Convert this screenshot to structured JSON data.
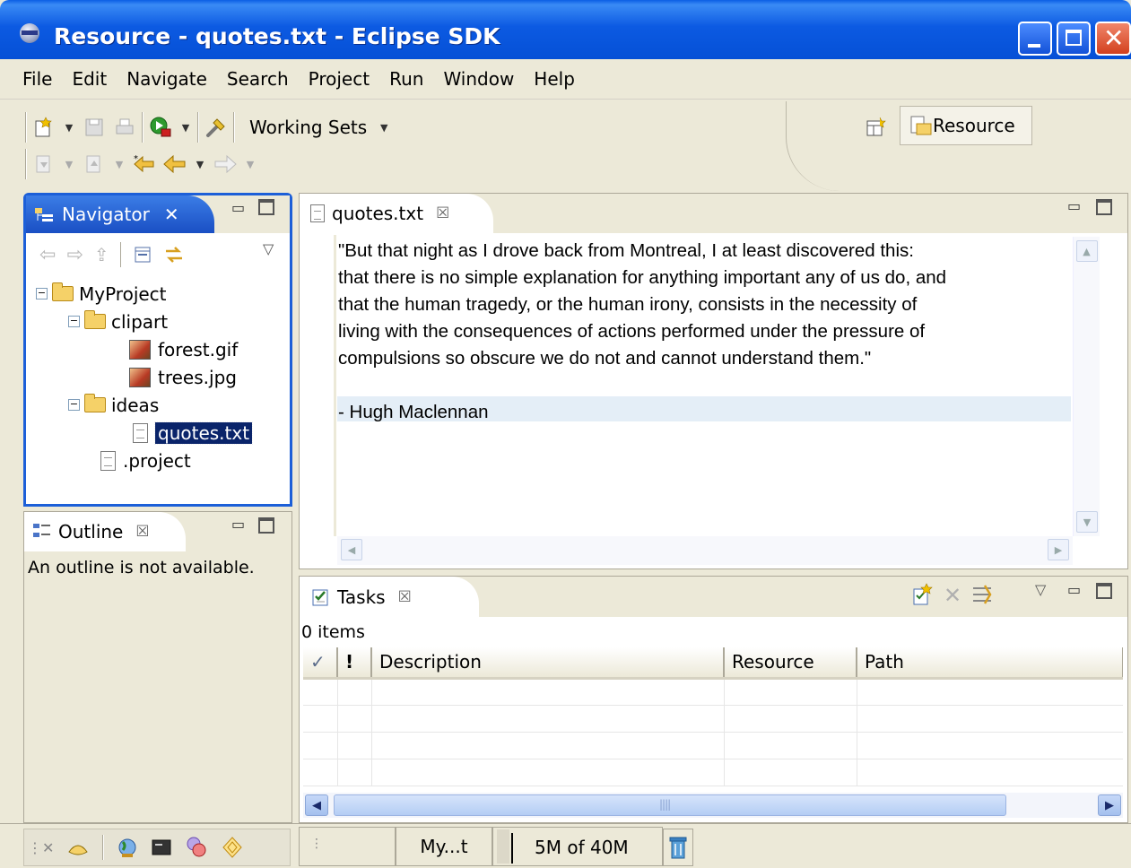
{
  "window": {
    "title": "Resource - quotes.txt - Eclipse SDK",
    "controls": [
      "minimize",
      "maximize",
      "close"
    ]
  },
  "menubar": {
    "items": [
      "File",
      "Edit",
      "Navigate",
      "Search",
      "Project",
      "Run",
      "Window",
      "Help"
    ]
  },
  "toolbar": {
    "working_sets_label": "Working Sets",
    "perspective_label": "Resource"
  },
  "navigator": {
    "tab_label": "Navigator",
    "tree": [
      {
        "label": "MyProject",
        "type": "folder"
      },
      {
        "label": "clipart",
        "type": "folder"
      },
      {
        "label": "forest.gif",
        "type": "image"
      },
      {
        "label": "trees.jpg",
        "type": "image"
      },
      {
        "label": "ideas",
        "type": "folder"
      },
      {
        "label": "quotes.txt",
        "type": "file",
        "selected": true
      },
      {
        "label": ".project",
        "type": "file"
      }
    ]
  },
  "outline": {
    "tab_label": "Outline",
    "message": "An outline is not available."
  },
  "editor": {
    "tab_label": "quotes.txt",
    "lines": [
      "\"But that night as I drove back from Montreal, I at least discovered this:",
      "that there is no simple explanation for anything important any of us do, and",
      "that the human tragedy, or the human irony, consists in the necessity of",
      "living with the consequences of actions performed under the pressure of",
      "compulsions so obscure we do not and cannot understand them.\"",
      "",
      "- Hugh Maclennan"
    ]
  },
  "tasks": {
    "tab_label": "Tasks",
    "count_label": "0 items",
    "columns": [
      "✓",
      "!",
      "Description",
      "Resource",
      "Path"
    ],
    "rows": []
  },
  "statusbar": {
    "project_label": "My...t",
    "memory_label": "5M of 40M"
  },
  "colors": {
    "titlebar": "#0550d6",
    "selection": "#0a246a",
    "active_tab": "#1c5fd8",
    "window_bg": "#ece9d8"
  }
}
